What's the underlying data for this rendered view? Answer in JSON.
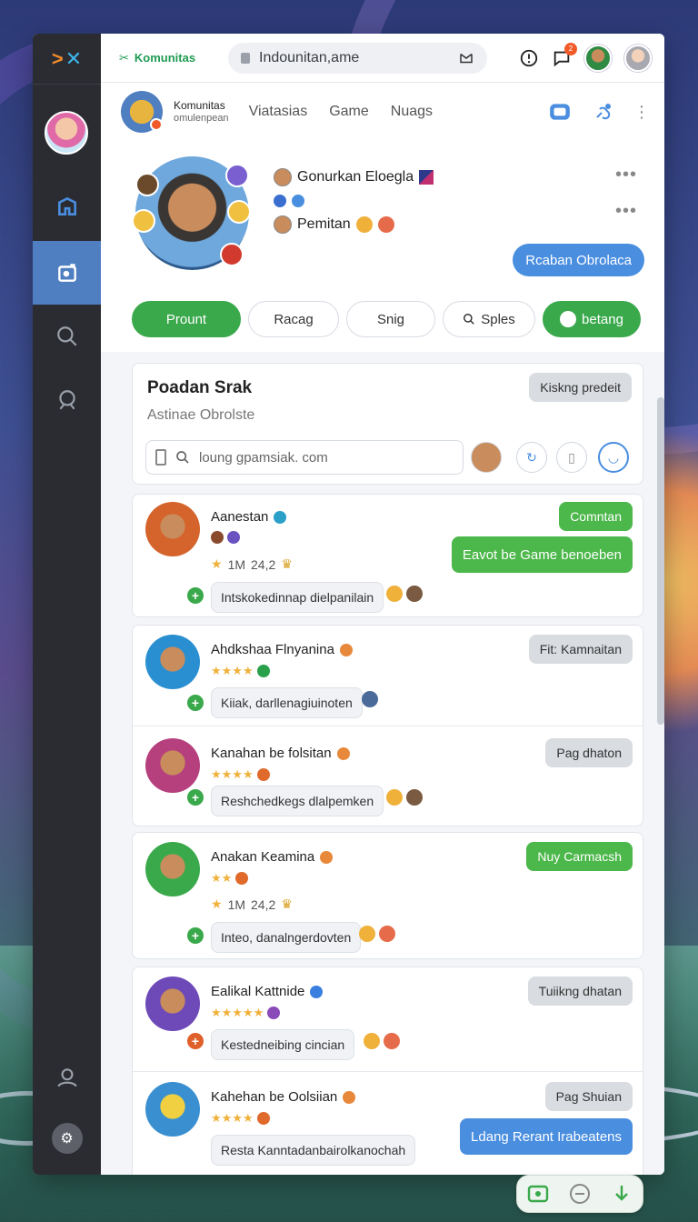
{
  "topbar": {
    "brand": "Komunitas",
    "address": "Indounitan,ame",
    "notification_count": "2"
  },
  "group": {
    "name": "Komunitas",
    "subtitle": "omulenpean",
    "nav": [
      "Viatasias",
      "Game",
      "Nuags"
    ]
  },
  "profile": {
    "line1": "Gonurkan Eloegla",
    "line3": "Pemitan",
    "chat_button": "Rcaban Obrolaca"
  },
  "tabs": [
    {
      "label": "Prount",
      "active": true
    },
    {
      "label": "Racag"
    },
    {
      "label": "Snig"
    },
    {
      "label": "Sples"
    },
    {
      "label": "betang",
      "accent": true
    }
  ],
  "search_card": {
    "title": "Poadan Srak",
    "subtitle": "Astinae Obrolste",
    "badge": "Kiskng predeit",
    "placeholder": "loung gpamsiak. com"
  },
  "users": [
    {
      "name": "Aanestan",
      "meta_a": "1M",
      "meta_b": "24,2",
      "message": "Intskokedinnap dielpanilain",
      "action1": "Comntan",
      "action2": "Eavot be Game benoeben",
      "stars": "",
      "avatar": "#d4642c"
    },
    {
      "name": "Ahdkshaa Flnyanina",
      "stars": "★★★★",
      "message": "Kiiak, darllenagiuinoten",
      "action1": "Fit: Kamnaitan",
      "avatar": "#2a8fd0"
    },
    {
      "name": "Kanahan be folsitan",
      "stars": "★★★★",
      "message": "Reshchedkegs dlalpemken",
      "action1": "Pag dhaton",
      "avatar": "#b5407d"
    },
    {
      "name": "Anakan Keamina",
      "stars": "★★",
      "meta_a": "1M",
      "meta_b": "24,2",
      "message": "Inteo, danalngerdovten",
      "action1": "Nuy Carmacsh",
      "avatar": "#3aa94b"
    },
    {
      "name": "Ealikal Kattnide",
      "stars": "★★★★★",
      "message": "Kestedneibing cincian",
      "action1": "Tuiikng dhatan",
      "avatar": "#6d4ab8"
    },
    {
      "name": "Kahehan be Oolsiian",
      "stars": "★★★★",
      "message": "Resta Kanntadanbairolkanochah",
      "action1": "Pag Shuian",
      "action2": "Ldang Rerant Irabeatens",
      "avatar": "#3a8fd0"
    }
  ]
}
